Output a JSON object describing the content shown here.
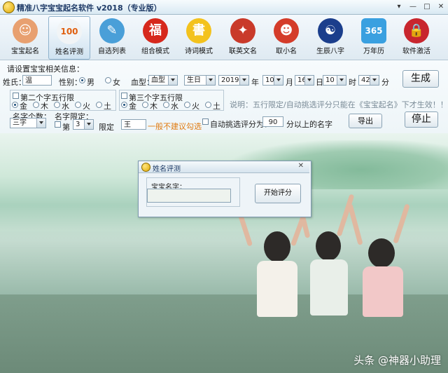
{
  "window": {
    "title": "精准八字宝宝起名软件 v2018（专业版）",
    "controls": {
      "menu": "▾",
      "minimize": "—",
      "maximize": "□",
      "close": "✕"
    }
  },
  "toolbar": [
    {
      "label": "宝宝起名",
      "icon": "baby-face-icon",
      "color": "#e8a070",
      "glyph": "☺"
    },
    {
      "label": "姓名评测",
      "icon": "score-100-icon",
      "color": "#f1f4f6",
      "glyph": "100"
    },
    {
      "label": "自选列表",
      "icon": "bird-book-icon",
      "color": "#4a9fd8",
      "glyph": "✎"
    },
    {
      "label": "组合模式",
      "icon": "lantern-icon",
      "color": "#d6281c",
      "glyph": "福"
    },
    {
      "label": "诗词模式",
      "icon": "open-book-icon",
      "color": "#f3c21d",
      "glyph": "書"
    },
    {
      "label": "联英文名",
      "icon": "mascot-icon",
      "color": "#c93a2a",
      "glyph": "✦"
    },
    {
      "label": "取小名",
      "icon": "monkey-icon",
      "color": "#d43c2a",
      "glyph": "☻"
    },
    {
      "label": "生辰八字",
      "icon": "yin-yang-icon",
      "color": "#1b3e8c",
      "glyph": "☯"
    },
    {
      "label": "万年历",
      "icon": "calendar-365-icon",
      "color": "#3aa0e0",
      "glyph": "365"
    },
    {
      "label": "软件激活",
      "icon": "lock-icon",
      "color": "#c8262e",
      "glyph": "🔒"
    }
  ],
  "form": {
    "section_title": "请设置宝宝相关信息：",
    "surname_label": "姓氏：",
    "surname_value": "温",
    "gender_label": "性别：",
    "gender_male": "男",
    "gender_female": "女",
    "blood_label": "血型：",
    "blood_value": "血型",
    "birthday_value": "生日",
    "year_value": "2019",
    "year_unit": "年",
    "month_value": "10",
    "month_unit": "月",
    "day_value": "16",
    "day_unit": "日",
    "hour_value": "10",
    "hour_unit": "时",
    "minute_value": "42",
    "minute_unit": "分",
    "generate_button": "生成",
    "group2_title": "第二个字五行限",
    "group3_title": "第三个字五行限",
    "elements": [
      "金",
      "木",
      "水",
      "火",
      "土"
    ],
    "note": "说明：五行限定/自动挑选评分只能在《宝宝起名》下才生效！！！！",
    "name_count_label": "名字个数：",
    "name_count_value": "三字",
    "name_limit_label": "名字限定：",
    "position_label": "第",
    "position_value": "3",
    "limit_label": "限定",
    "limit_value": "王",
    "limit_hint": "一般不建议勾选",
    "auto_score_label": "自动挑选评分为：",
    "auto_score_value": "90",
    "auto_score_suffix": "分以上的名字",
    "export_button": "导出",
    "stop_button": "停止"
  },
  "dialog": {
    "title": "姓名评测",
    "name_label": "宝宝名字：",
    "name_value": "",
    "start_button": "开始评分",
    "close": "✕"
  },
  "watermark": "头条 @神器小助理"
}
